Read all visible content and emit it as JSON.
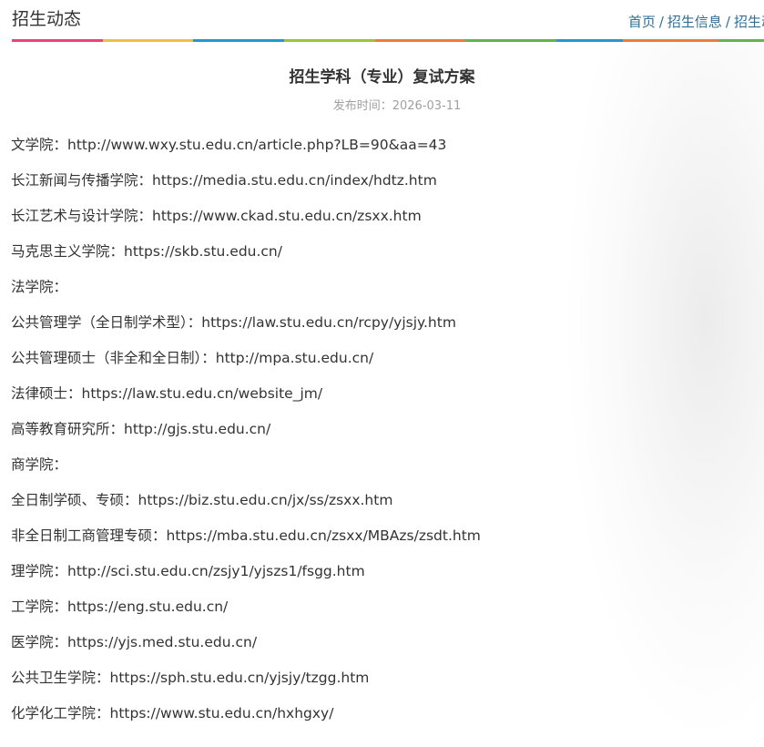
{
  "header": {
    "section_title": "招生动态",
    "breadcrumb": [
      "首页",
      "招生信息",
      "招生动"
    ],
    "color_bar": [
      "#e8437a",
      "#f2bf3c",
      "#2596d1",
      "#9ac43c",
      "#ef7a3c",
      "#63b548",
      "#2596d1",
      "#ef7a3c",
      "#63b548"
    ]
  },
  "article": {
    "title": "招生学科（专业）复试方案",
    "date": "发布时间：2026-03-11",
    "lines": [
      "文学院：http://www.wxy.stu.edu.cn/article.php?LB=90&aa=43",
      "长江新闻与传播学院：https://media.stu.edu.cn/index/hdtz.htm",
      "长江艺术与设计学院：https://www.ckad.stu.edu.cn/zsxx.htm",
      "马克思主义学院：https://skb.stu.edu.cn/",
      "法学院：",
      "公共管理学（全日制学术型）：https://law.stu.edu.cn/rcpy/yjsjy.htm",
      "公共管理硕士（非全和全日制）：http://mpa.stu.edu.cn/",
      "法律硕士：https://law.stu.edu.cn/website_jm/",
      "高等教育研究所：http://gjs.stu.edu.cn/",
      "商学院：",
      "全日制学硕、专硕：https://biz.stu.edu.cn/jx/ss/zsxx.htm",
      "非全日制工商管理专硕：https://mba.stu.edu.cn/zsxx/MBAzs/zsdt.htm",
      "理学院：http://sci.stu.edu.cn/zsjy1/yjszs1/fsgg.htm",
      "工学院：https://eng.stu.edu.cn/",
      "医学院：https://yjs.med.stu.edu.cn/",
      "公共卫生学院：https://sph.stu.edu.cn/yjsjy/tzgg.htm",
      "化学化工学院：https://www.stu.edu.cn/hxhgxy/"
    ]
  }
}
